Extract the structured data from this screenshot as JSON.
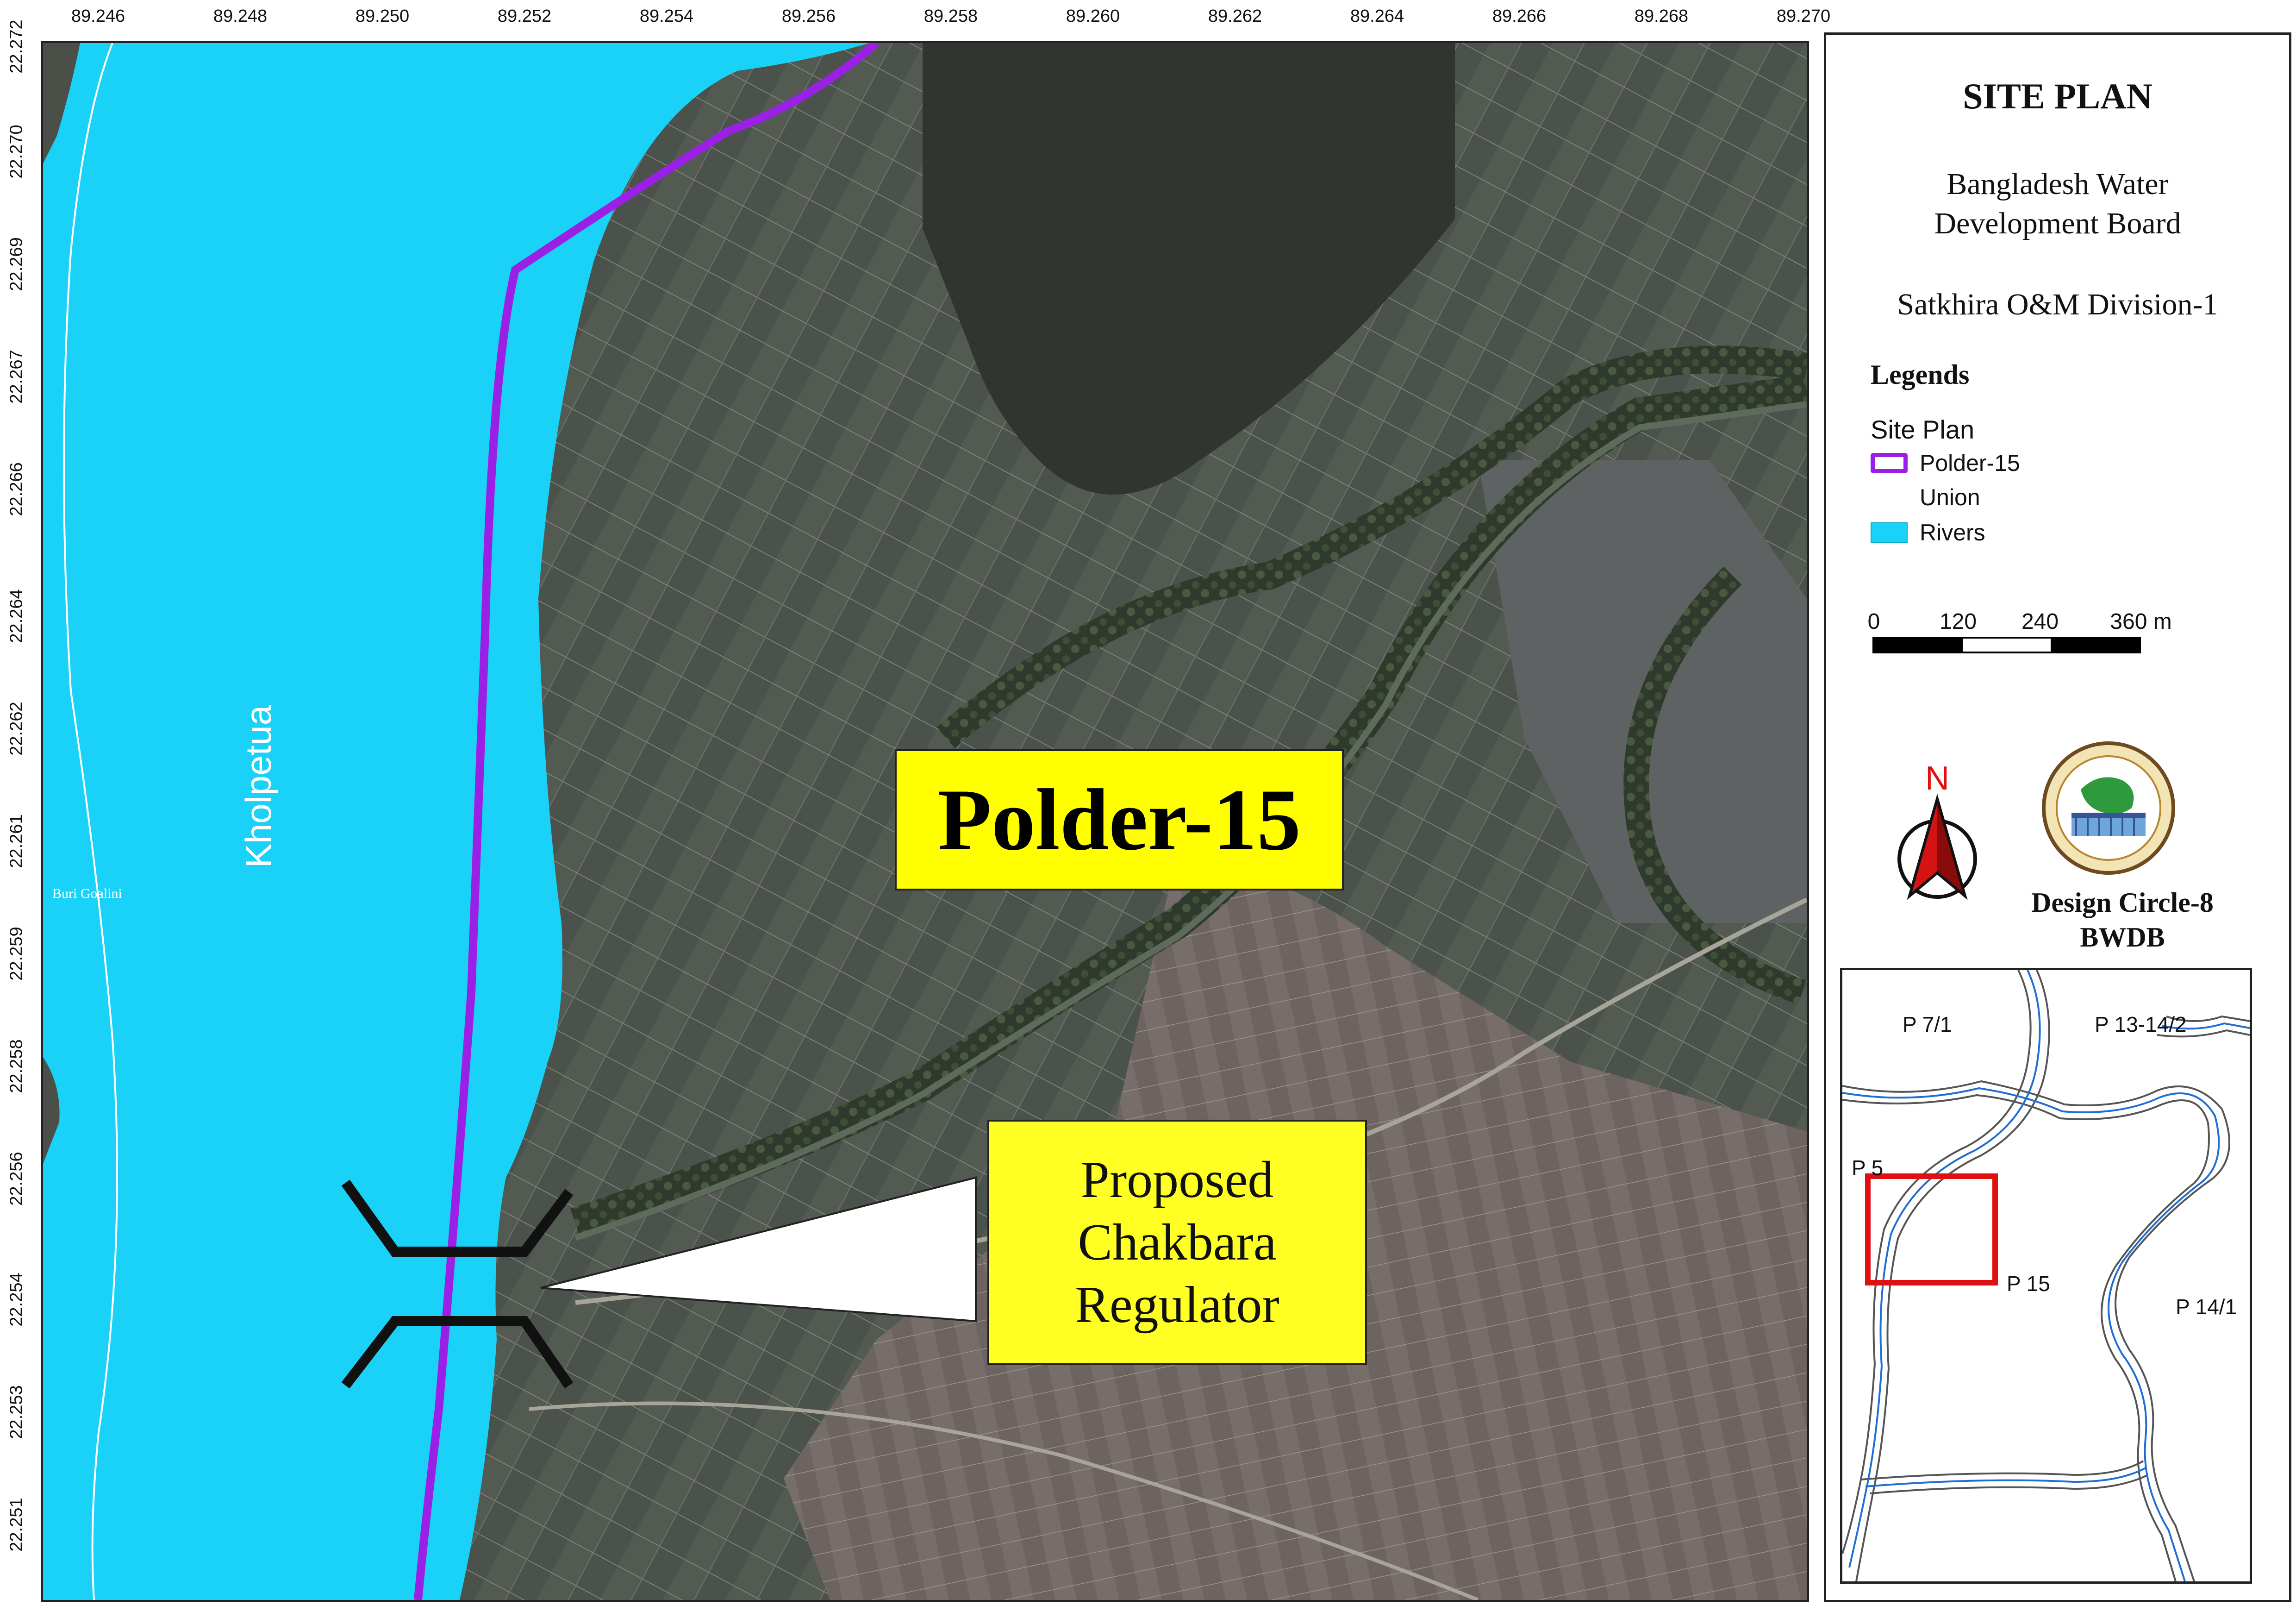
{
  "axes": {
    "x_ticks": [
      "89.246",
      "89.248",
      "89.250",
      "89.252",
      "89.254",
      "89.256",
      "89.258",
      "89.260",
      "89.262",
      "89.264",
      "89.266",
      "89.268",
      "89.270"
    ],
    "y_ticks": [
      "22.272",
      "22.270",
      "22.269",
      "22.267",
      "22.266",
      "22.264",
      "22.262",
      "22.261",
      "22.259",
      "22.258",
      "22.256",
      "22.254",
      "22.253",
      "22.251"
    ]
  },
  "map": {
    "polder_label": "Polder-15",
    "regulator_lines": [
      "Proposed",
      "Chakbara",
      "Regulator"
    ],
    "river_name": "Kholpetua",
    "village_name": "Buri Goalini",
    "colors": {
      "river": "#1ad2f7",
      "polder_line": "#9b20e6",
      "label_bg": "#ffff00"
    }
  },
  "panel": {
    "title": "SITE PLAN",
    "org_line1": "Bangladesh Water",
    "org_line2": "Development Board",
    "division": "Satkhira O&M Division-1",
    "legends_heading": "Legends",
    "legend_group": "Site Plan",
    "legend_items": {
      "polder": "Polder-15",
      "union": "Union",
      "rivers": "Rivers"
    },
    "scale": {
      "labels": [
        "0",
        "120",
        "240",
        "360 m"
      ]
    },
    "north_label": "N",
    "design_circle": "Design Circle-8",
    "bwdb": "BWDB",
    "logo_icon": "bwdb-emblem-icon"
  },
  "inset": {
    "labels": {
      "p71": "P 7/1",
      "p13": "P 13-14/2",
      "p5": "P 5",
      "p15": "P 15",
      "p141": "P 14/1"
    }
  }
}
